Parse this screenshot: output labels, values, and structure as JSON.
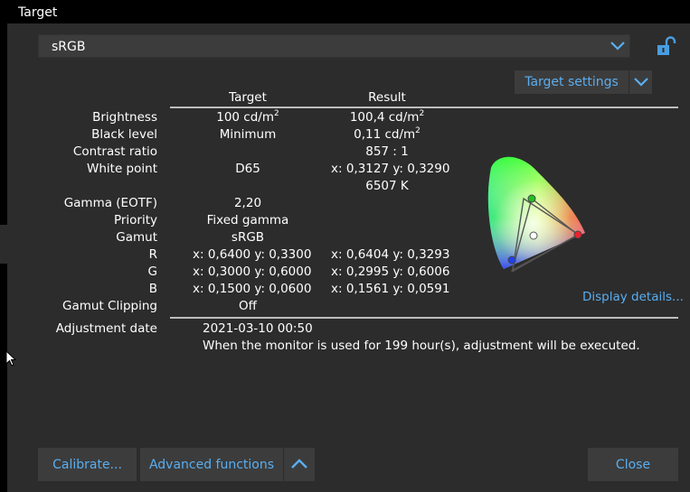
{
  "window": {
    "title": "Target"
  },
  "profile": {
    "selected": "sRGB"
  },
  "target_settings": {
    "label": "Target settings"
  },
  "table": {
    "headers": {
      "target": "Target",
      "result": "Result"
    },
    "rows": {
      "brightness": {
        "label": "Brightness",
        "target_value": "100 cd/m",
        "target_sup": "2",
        "result_value": "100,4 cd/m",
        "result_sup": "2"
      },
      "black_level": {
        "label": "Black level",
        "target_value": "Minimum",
        "result_value": "0,11 cd/m",
        "result_sup": "2"
      },
      "contrast_ratio": {
        "label": "Contrast ratio",
        "result_value": "857 : 1"
      },
      "white_point": {
        "label": "White point",
        "target_value": "D65",
        "result_value": "x: 0,3127  y: 0,3290",
        "result_value2": "6507 K"
      },
      "gamma": {
        "label": "Gamma (EOTF)",
        "target_value": "2,20"
      },
      "priority": {
        "label": "Priority",
        "target_value": "Fixed gamma"
      },
      "gamut": {
        "label": "Gamut",
        "target_value": "sRGB"
      },
      "r": {
        "label": "R",
        "target_value": "x: 0,6400  y: 0,3300",
        "result_value": "x: 0,6404  y: 0,3293"
      },
      "g": {
        "label": "G",
        "target_value": "x: 0,3000  y: 0,6000",
        "result_value": "x: 0,2995  y: 0,6006"
      },
      "b": {
        "label": "B",
        "target_value": "x: 0,1500  y: 0,0600",
        "result_value": "x: 0,1561  y: 0,0591"
      },
      "gamut_clipping": {
        "label": "Gamut Clipping",
        "target_value": "Off"
      }
    }
  },
  "display_details": {
    "label": "Display details..."
  },
  "adjustment": {
    "label": "Adjustment date",
    "date": "2021-03-10 00:50",
    "note": "When the monitor is used for 199 hour(s), adjustment will be executed."
  },
  "buttons": {
    "calibrate": "Calibrate...",
    "advanced": "Advanced functions",
    "close": "Close"
  },
  "icons": {
    "dropdown": "chevron-down-icon",
    "lock": "unlock-icon",
    "expand": "chevron-up-icon",
    "gamut": "cie-gamut-diagram-icon"
  },
  "colors": {
    "accent": "#5aaef0",
    "panel": "#2c2c2c",
    "control": "#3c3c3c"
  }
}
